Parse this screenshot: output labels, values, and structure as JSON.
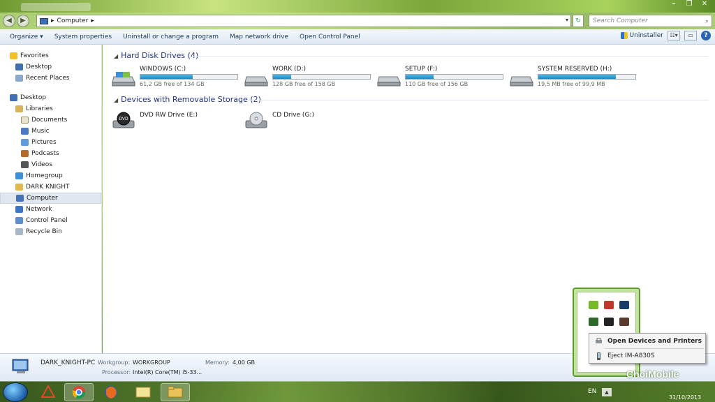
{
  "window": {
    "tab_title": "",
    "minimize": "–",
    "maximize": "❐",
    "close": "✕"
  },
  "address": {
    "path": "Computer",
    "search_placeholder": "Search Computer"
  },
  "toolbar": {
    "organize": "Organize ▾",
    "system_properties": "System properties",
    "uninstall": "Uninstall or change a program",
    "map_drive": "Map network drive",
    "control_panel": "Open Control Panel",
    "uninstaller": "Uninstaller"
  },
  "nav": {
    "favorites": "Favorites",
    "fav_desktop": "Desktop",
    "recent_places": "Recent Places",
    "desktop": "Desktop",
    "libraries": "Libraries",
    "documents": "Documents",
    "music": "Music",
    "pictures": "Pictures",
    "podcasts": "Podcasts",
    "videos": "Videos",
    "homegroup": "Homegroup",
    "dark_knight": "DARK KNIGHT",
    "computer": "Computer",
    "network": "Network",
    "control_panel": "Control Panel",
    "recycle_bin": "Recycle Bin"
  },
  "groups": {
    "hdd": "Hard Disk Drives (4)",
    "removable": "Devices with Removable Storage (2)"
  },
  "drives": [
    {
      "name": "WINDOWS (C:)",
      "free": "61,2 GB free of 134 GB",
      "used_fraction": 0.54
    },
    {
      "name": "WORK (D:)",
      "free": "128 GB free of 158 GB",
      "used_fraction": 0.19
    },
    {
      "name": "SETUP (F:)",
      "free": "110 GB free of 156 GB",
      "used_fraction": 0.29
    },
    {
      "name": "SYSTEM RESERVED (H:)",
      "free": "19,5 MB free of 99,9 MB",
      "used_fraction": 0.8
    }
  ],
  "removable": [
    {
      "name": "DVD RW Drive (E:)",
      "icon_label": "DVD"
    },
    {
      "name": "CD Drive (G:)"
    }
  ],
  "details": {
    "pc_name": "DARK_KNIGHT-PC",
    "workgroup_label": "Workgroup:",
    "workgroup": "WORKGROUP",
    "memory_label": "Memory:",
    "memory": "4,00 GB",
    "processor_label": "Processor:",
    "processor": "Intel(R) Core(TM) i5-33..."
  },
  "taskbar": {
    "lang": "EN",
    "date": "31/10/2013"
  },
  "context_menu": {
    "open_devices": "Open Devices and Printers",
    "eject": "Eject IM-A830S"
  },
  "watermark": {
    "brand": "ChoiMobile",
    "sub": ""
  }
}
